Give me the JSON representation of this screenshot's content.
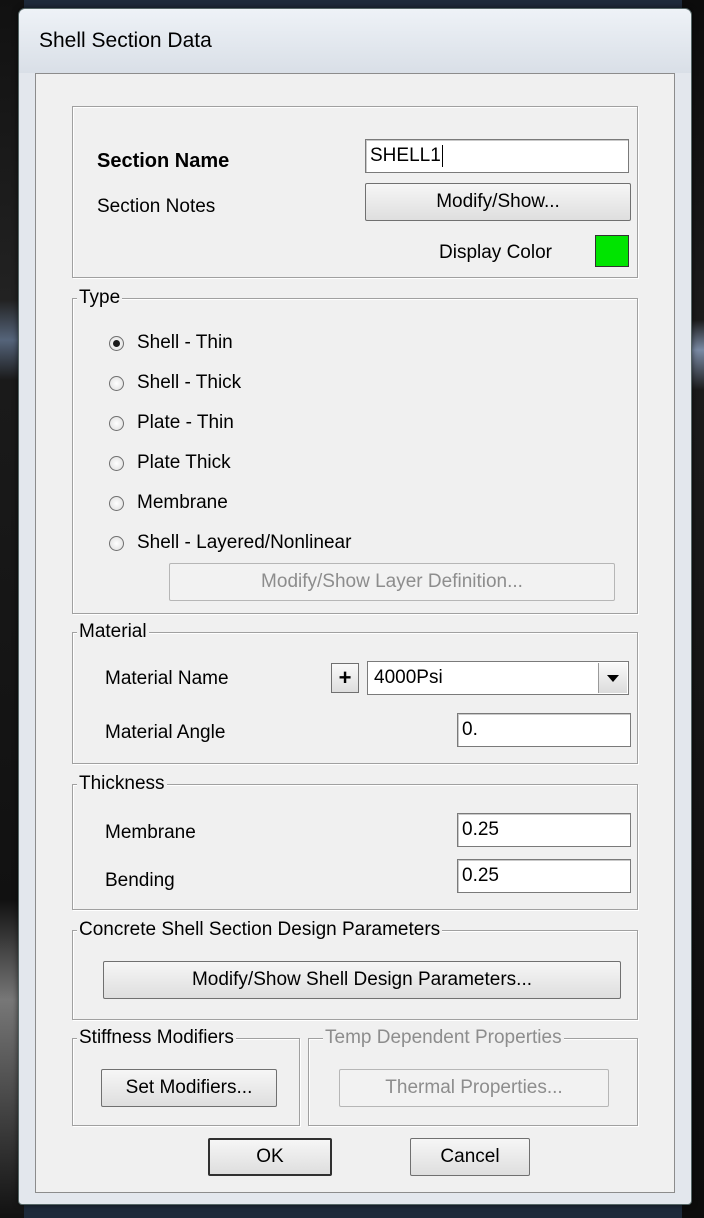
{
  "window": {
    "title": "Shell Section Data"
  },
  "section": {
    "name_label": "Section Name",
    "name_value": "SHELL1",
    "notes_label": "Section Notes",
    "notes_button": "Modify/Show...",
    "color_label": "Display Color",
    "display_color": "#00e400"
  },
  "type": {
    "legend": "Type",
    "options": [
      {
        "label": "Shell - Thin",
        "selected": true
      },
      {
        "label": "Shell - Thick",
        "selected": false
      },
      {
        "label": "Plate - Thin",
        "selected": false
      },
      {
        "label": "Plate Thick",
        "selected": false
      },
      {
        "label": "Membrane",
        "selected": false
      },
      {
        "label": "Shell - Layered/Nonlinear",
        "selected": false
      }
    ],
    "layer_button": "Modify/Show Layer Definition..."
  },
  "material": {
    "legend": "Material",
    "name_label": "Material Name",
    "add_button": "+",
    "name_value": "4000Psi",
    "angle_label": "Material Angle",
    "angle_value": "0."
  },
  "thickness": {
    "legend": "Thickness",
    "membrane_label": "Membrane",
    "membrane_value": "0.25",
    "bending_label": "Bending",
    "bending_value": "0.25"
  },
  "design": {
    "legend": "Concrete Shell Section Design Parameters",
    "button": "Modify/Show Shell Design Parameters..."
  },
  "stiffness": {
    "legend": "Stiffness Modifiers",
    "button": "Set Modifiers..."
  },
  "temp": {
    "legend": "Temp Dependent Properties",
    "button": "Thermal Properties..."
  },
  "footer": {
    "ok": "OK",
    "cancel": "Cancel"
  }
}
